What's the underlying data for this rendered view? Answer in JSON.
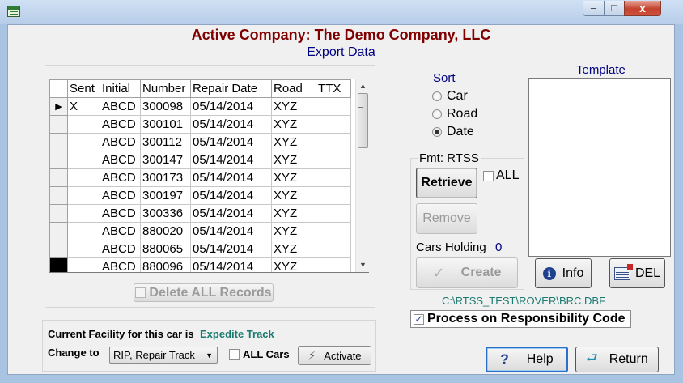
{
  "window": {
    "close_glyph": "x",
    "max_glyph": "□",
    "min_glyph": "‒"
  },
  "header": {
    "company": "Active Company: The Demo Company, LLC",
    "subtitle": "Export Data"
  },
  "grid": {
    "columns": [
      "Sent",
      "Initial",
      "Number",
      "Repair Date",
      "Road",
      "TTX"
    ],
    "rows": [
      {
        "sent": "X",
        "initial": "ABCD",
        "number": "300098",
        "repair_date": "05/14/2014",
        "road": "XYZ",
        "ttx": ""
      },
      {
        "sent": "",
        "initial": "ABCD",
        "number": "300101",
        "repair_date": "05/14/2014",
        "road": "XYZ",
        "ttx": ""
      },
      {
        "sent": "",
        "initial": "ABCD",
        "number": "300112",
        "repair_date": "05/14/2014",
        "road": "XYZ",
        "ttx": ""
      },
      {
        "sent": "",
        "initial": "ABCD",
        "number": "300147",
        "repair_date": "05/14/2014",
        "road": "XYZ",
        "ttx": ""
      },
      {
        "sent": "",
        "initial": "ABCD",
        "number": "300173",
        "repair_date": "05/14/2014",
        "road": "XYZ",
        "ttx": ""
      },
      {
        "sent": "",
        "initial": "ABCD",
        "number": "300197",
        "repair_date": "05/14/2014",
        "road": "XYZ",
        "ttx": ""
      },
      {
        "sent": "",
        "initial": "ABCD",
        "number": "300336",
        "repair_date": "05/14/2014",
        "road": "XYZ",
        "ttx": ""
      },
      {
        "sent": "",
        "initial": "ABCD",
        "number": "880020",
        "repair_date": "05/14/2014",
        "road": "XYZ",
        "ttx": ""
      },
      {
        "sent": "",
        "initial": "ABCD",
        "number": "880065",
        "repair_date": "05/14/2014",
        "road": "XYZ",
        "ttx": ""
      },
      {
        "sent": "",
        "initial": "ABCD",
        "number": "880096",
        "repair_date": "05/14/2014",
        "road": "XYZ",
        "ttx": ""
      }
    ],
    "current_row_marker": "▶"
  },
  "delete_all_label": "Delete ALL Records",
  "sort": {
    "label": "Sort",
    "options": [
      "Car",
      "Road",
      "Date"
    ],
    "selected": "Date"
  },
  "fmt": {
    "label": "Fmt: RTSS",
    "retrieve_label": "Retrieve",
    "all_label": "ALL",
    "remove_label": "Remove",
    "cars_holding_label": "Cars Holding",
    "cars_holding_count": "0",
    "create_label": "Create"
  },
  "template": {
    "label": "Template",
    "info_label": "Info",
    "del_label": "DEL"
  },
  "path": "C:\\RTSS_TEST\\ROVER\\BRC.DBF",
  "responsibility": {
    "label": "Process on Responsibility Code",
    "checked": true
  },
  "facility": {
    "label": "Current Facility for this car is",
    "value": "Expedite Track",
    "change_to_label": "Change to",
    "change_to_value": "RIP, Repair Track",
    "all_cars_label": "ALL Cars",
    "activate_label": "Activate"
  },
  "footer": {
    "help_label": "Help",
    "return_label": "Return"
  },
  "colors": {
    "title": "#800000",
    "accent": "#000080",
    "teal": "#1a7a70"
  }
}
